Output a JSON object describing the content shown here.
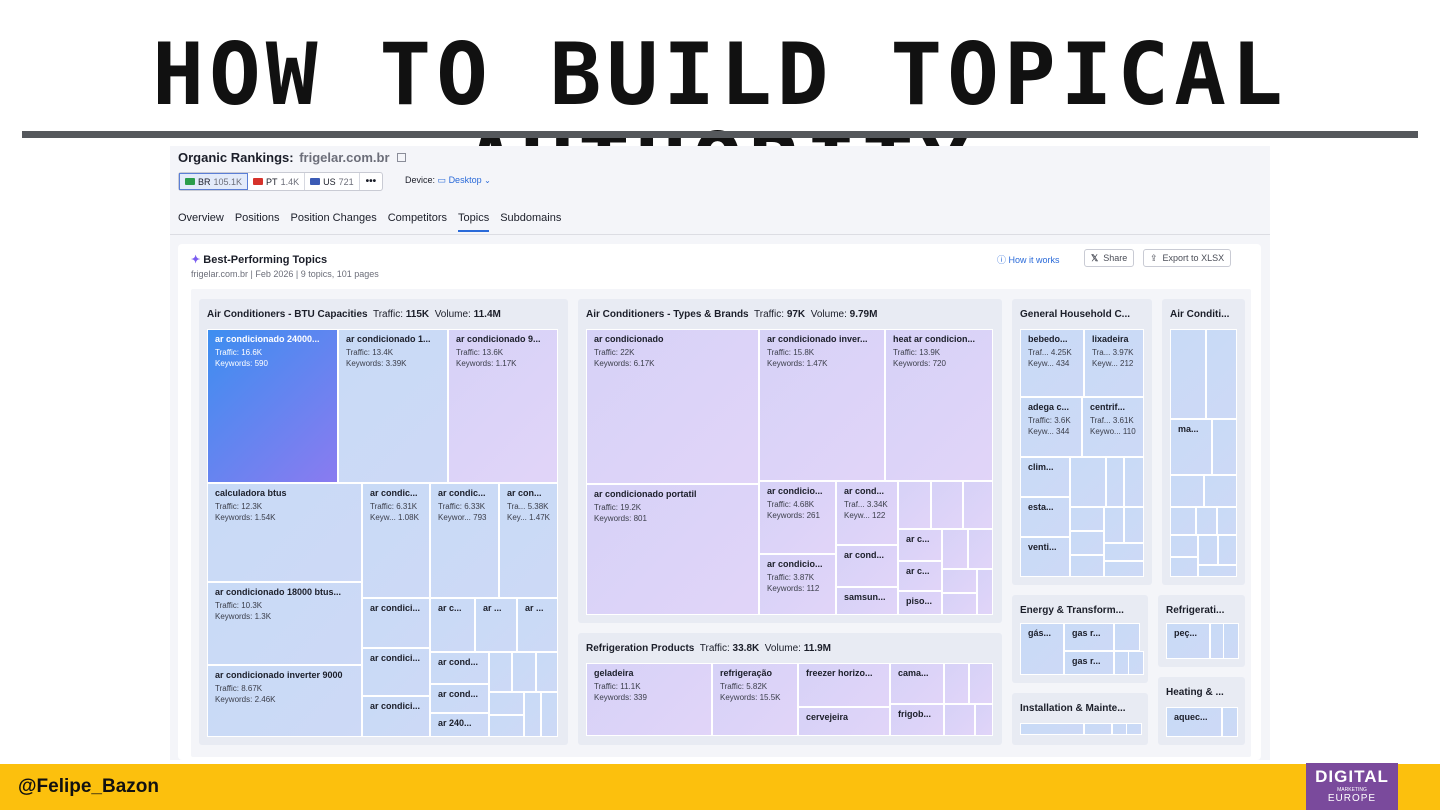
{
  "slide": {
    "title": "HOW TO BUILD TOPICAL AUTHORITY",
    "handle": "Felipe_Bazon",
    "handle_symbol": "@",
    "logo": {
      "line1": "DIGITAL",
      "line2": "MARKETING",
      "line3": "EUROPE"
    }
  },
  "header": {
    "title": "Organic Rankings:",
    "domain": "frigelar.com.br",
    "device_label": "Device:",
    "device_value": "Desktop"
  },
  "databases": [
    {
      "code": "BR",
      "count": "105.1K",
      "flag": "#2a9d4b"
    },
    {
      "code": "PT",
      "count": "1.4K",
      "flag": "#d6322b"
    },
    {
      "code": "US",
      "count": "721",
      "flag": "#3b5bb5"
    }
  ],
  "more_label": "•••",
  "tabs": [
    "Overview",
    "Positions",
    "Position Changes",
    "Competitors",
    "Topics",
    "Subdomains"
  ],
  "panel": {
    "title": "Best-Performing Topics",
    "subtitle": "frigelar.com.br  |  Feb 2026  |  9 topics, 101 pages",
    "how_it_works": "How it works",
    "share": "Share",
    "export": "Export to XLSX"
  },
  "labels": {
    "traffic": "Traffic:",
    "volume": "Volume:"
  },
  "groups": [
    {
      "name": "Air Conditioners - BTU Capacities",
      "traffic": "115K",
      "volume": "11.4M"
    },
    {
      "name": "Air Conditioners - Types & Brands",
      "traffic": "97K",
      "volume": "9.79M"
    },
    {
      "name": "General Household C...",
      "traffic": "",
      "volume": ""
    },
    {
      "name": "Air Conditi...",
      "traffic": "",
      "volume": ""
    },
    {
      "name": "Refrigeration Products",
      "traffic": "33.8K",
      "volume": "11.9M"
    },
    {
      "name": "Energy & Transform...",
      "traffic": "",
      "volume": ""
    },
    {
      "name": "Refrigerati...",
      "traffic": "",
      "volume": ""
    },
    {
      "name": "Installation & Mainte...",
      "traffic": "",
      "volume": ""
    },
    {
      "name": "Heating & ...",
      "traffic": "",
      "volume": ""
    }
  ],
  "cells": [
    {
      "t": "ar condicionado 24000...",
      "m1": "Traffic: 16.6K",
      "m2": "Keywords: 590"
    },
    {
      "t": "ar condicionado 1...",
      "m1": "Traffic: 13.4K",
      "m2": "Keywords: 3.39K"
    },
    {
      "t": "ar condicionado 9...",
      "m1": "Traffic: 13.6K",
      "m2": "Keywords: 1.17K"
    },
    {
      "t": "calculadora btus",
      "m1": "Traffic: 12.3K",
      "m2": "Keywords: 1.54K"
    },
    {
      "t": "ar condic...",
      "m1": "Traffic: 6.31K",
      "m2": "Keyw...  1.08K"
    },
    {
      "t": "ar condic...",
      "m1": "Traffic: 6.33K",
      "m2": "Keywor...  793"
    },
    {
      "t": "ar con...",
      "m1": "Tra...  5.38K",
      "m2": "Key...  1.47K"
    },
    {
      "t": "ar condicionado 18000 btus...",
      "m1": "Traffic: 10.3K",
      "m2": "Keywords: 1.3K"
    },
    {
      "t": "ar condici...",
      "m1": "",
      "m2": ""
    },
    {
      "t": "ar c...",
      "m1": "",
      "m2": ""
    },
    {
      "t": "ar ...",
      "m1": "",
      "m2": ""
    },
    {
      "t": "ar ...",
      "m1": "",
      "m2": ""
    },
    {
      "t": "ar condicionado inverter 9000",
      "m1": "Traffic: 8.67K",
      "m2": "Keywords: 2.46K"
    },
    {
      "t": "ar condici...",
      "m1": "",
      "m2": ""
    },
    {
      "t": "ar cond...",
      "m1": "",
      "m2": ""
    },
    {
      "t": "ar condici...",
      "m1": "",
      "m2": ""
    },
    {
      "t": "ar cond...",
      "m1": "",
      "m2": ""
    },
    {
      "t": "ar 240...",
      "m1": "",
      "m2": ""
    },
    {
      "t": "ar condicionado",
      "m1": "Traffic: 22K",
      "m2": "Keywords: 6.17K"
    },
    {
      "t": "ar condicionado inver...",
      "m1": "Traffic: 15.8K",
      "m2": "Keywords: 1.47K"
    },
    {
      "t": "heat ar condicion...",
      "m1": "Traffic: 13.9K",
      "m2": "Keywords: 720"
    },
    {
      "t": "ar condicionado portatil",
      "m1": "Traffic: 19.2K",
      "m2": "Keywords: 801"
    },
    {
      "t": "ar condicio...",
      "m1": "Traffic: 4.68K",
      "m2": "Keywords: 261"
    },
    {
      "t": "ar cond...",
      "m1": "Traf...  3.34K",
      "m2": "Keyw...  122"
    },
    {
      "t": "ar condicio...",
      "m1": "Traffic: 3.87K",
      "m2": "Keywords: 112"
    },
    {
      "t": "ar cond...",
      "m1": "",
      "m2": ""
    },
    {
      "t": "ar c...",
      "m1": "",
      "m2": ""
    },
    {
      "t": "ar c...",
      "m1": "",
      "m2": ""
    },
    {
      "t": "samsun...",
      "m1": "",
      "m2": ""
    },
    {
      "t": "piso...",
      "m1": "",
      "m2": ""
    },
    {
      "t": "bebedo...",
      "m1": "Traf...  4.25K",
      "m2": "Keyw...  434"
    },
    {
      "t": "lixadeira",
      "m1": "Tra...  3.97K",
      "m2": "Keyw...  212"
    },
    {
      "t": "adega c...",
      "m1": "Traffic: 3.6K",
      "m2": "Keyw...  344"
    },
    {
      "t": "centrif...",
      "m1": "Traf...  3.61K",
      "m2": "Keywo...  110"
    },
    {
      "t": "clim...",
      "m1": "",
      "m2": ""
    },
    {
      "t": "esta...",
      "m1": "",
      "m2": ""
    },
    {
      "t": "venti...",
      "m1": "",
      "m2": ""
    },
    {
      "t": "ma...",
      "m1": "",
      "m2": ""
    },
    {
      "t": "geladeira",
      "m1": "Traffic: 11.1K",
      "m2": "Keywords: 339"
    },
    {
      "t": "refrigeração",
      "m1": "Traffic: 5.82K",
      "m2": "Keywords: 15.5K"
    },
    {
      "t": "freezer horizo...",
      "m1": "",
      "m2": ""
    },
    {
      "t": "cama...",
      "m1": "",
      "m2": ""
    },
    {
      "t": "cervejeira",
      "m1": "",
      "m2": ""
    },
    {
      "t": "frigob...",
      "m1": "",
      "m2": ""
    },
    {
      "t": "gás...",
      "m1": "",
      "m2": ""
    },
    {
      "t": "gas r...",
      "m1": "",
      "m2": ""
    },
    {
      "t": "gas r...",
      "m1": "",
      "m2": ""
    },
    {
      "t": "peç...",
      "m1": "",
      "m2": ""
    },
    {
      "t": "aquec...",
      "m1": "",
      "m2": ""
    }
  ]
}
